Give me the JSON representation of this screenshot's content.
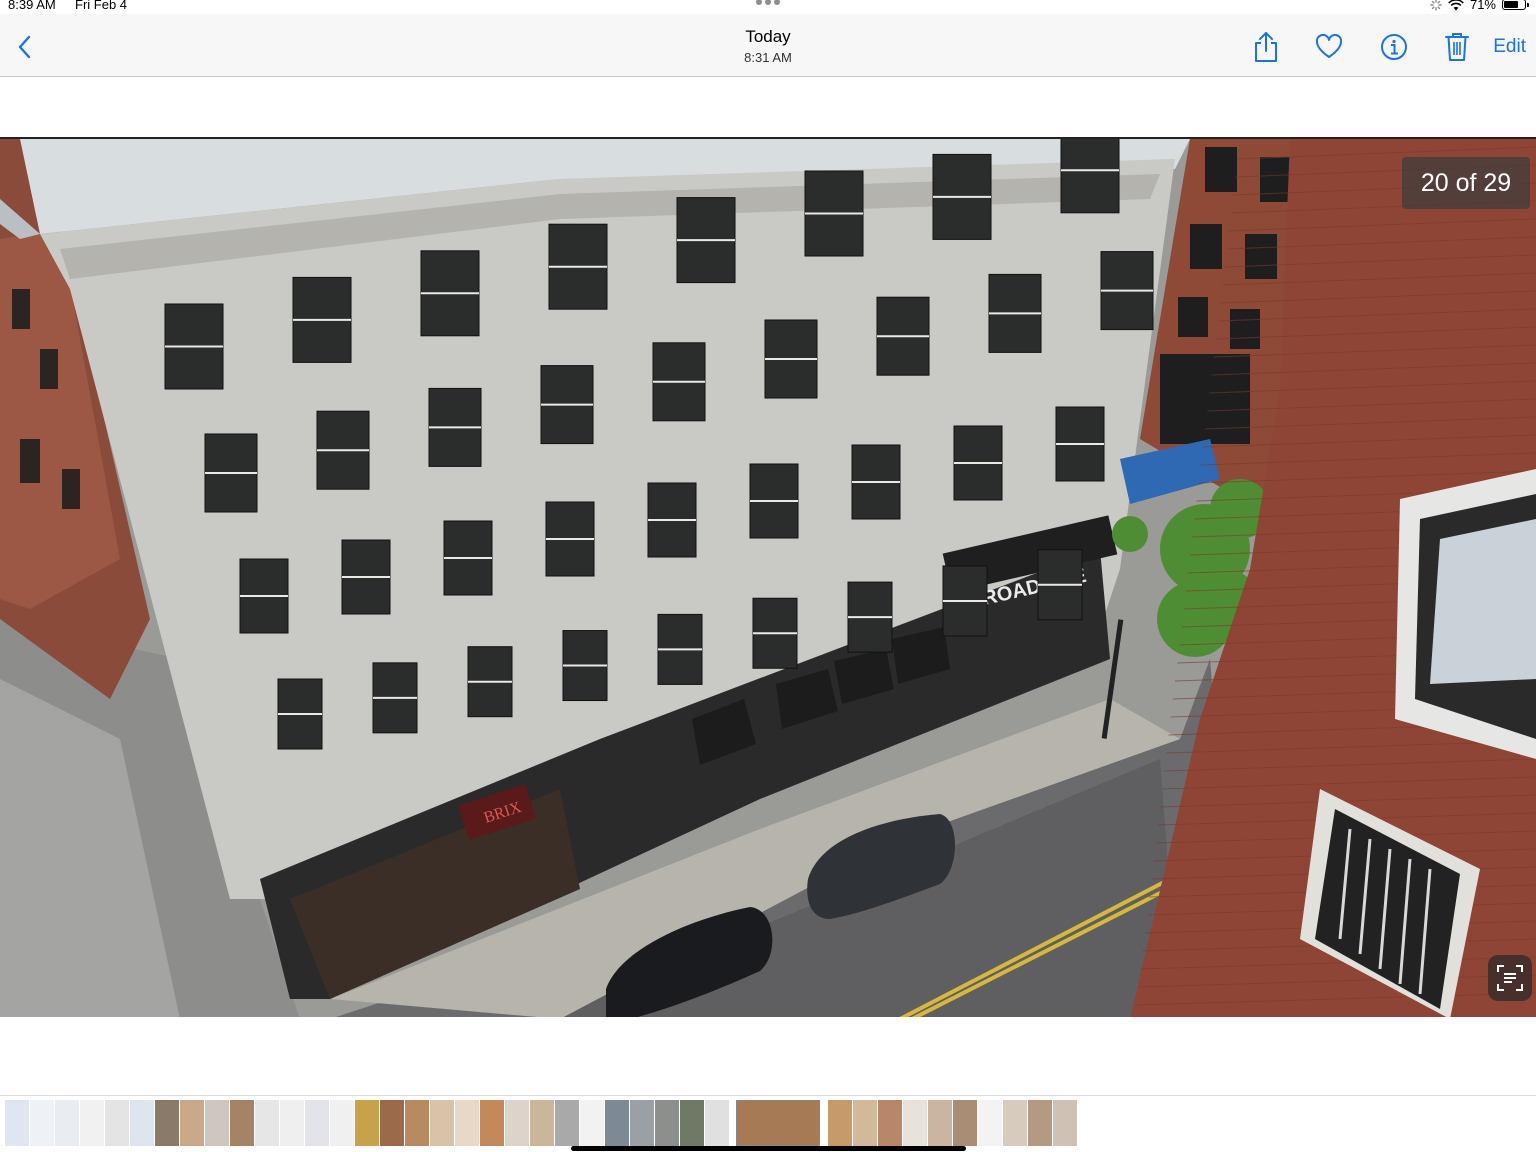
{
  "status_bar": {
    "time": "8:39 AM",
    "date": "Fri Feb 4",
    "battery_percent": "71%",
    "battery_level": 0.71
  },
  "nav": {
    "title": "Today",
    "subtitle": "8:31 AM",
    "edit_label": "Edit",
    "icons": [
      "chevron-left-icon",
      "share-icon",
      "heart-icon",
      "info-icon",
      "trash-icon"
    ],
    "accent_color": "#1a73e8"
  },
  "photo": {
    "counter": "20 of 29",
    "signage": [
      "BROADSIDE",
      "BRIX"
    ],
    "live_text_icon": "live-text-icon"
  },
  "thumbnails": {
    "count": 40,
    "palette": [
      "#dfe6f2",
      "#eef1f6",
      "#e9ecf0",
      "#f1f1f1",
      "#e4e4e4",
      "#dde6ee",
      "#8a7a6a",
      "#c9a98a",
      "#cfc7bf",
      "#a58365",
      "#e6e6e6",
      "#efefef",
      "#e2e4ea",
      "#f0f0f0",
      "#c8a24a",
      "#9a6a4a",
      "#b88a60",
      "#d8c3a8",
      "#e7d8c8",
      "#c4895a",
      "#dcd3cb",
      "#cbb59b",
      "#a9a9a9",
      "#f2f2f2",
      "#7d8a96",
      "#9aa0a6",
      "#8c8f8c",
      "#6f7a66",
      "#e0e0e0",
      "#a67a55",
      "#c79a6a",
      "#d3b899",
      "#b8876a",
      "#e8e2da",
      "#c9b5a0",
      "#a98d74",
      "#f3f3f3",
      "#d6cbbd",
      "#b49a82",
      "#cfc2b4"
    ]
  }
}
